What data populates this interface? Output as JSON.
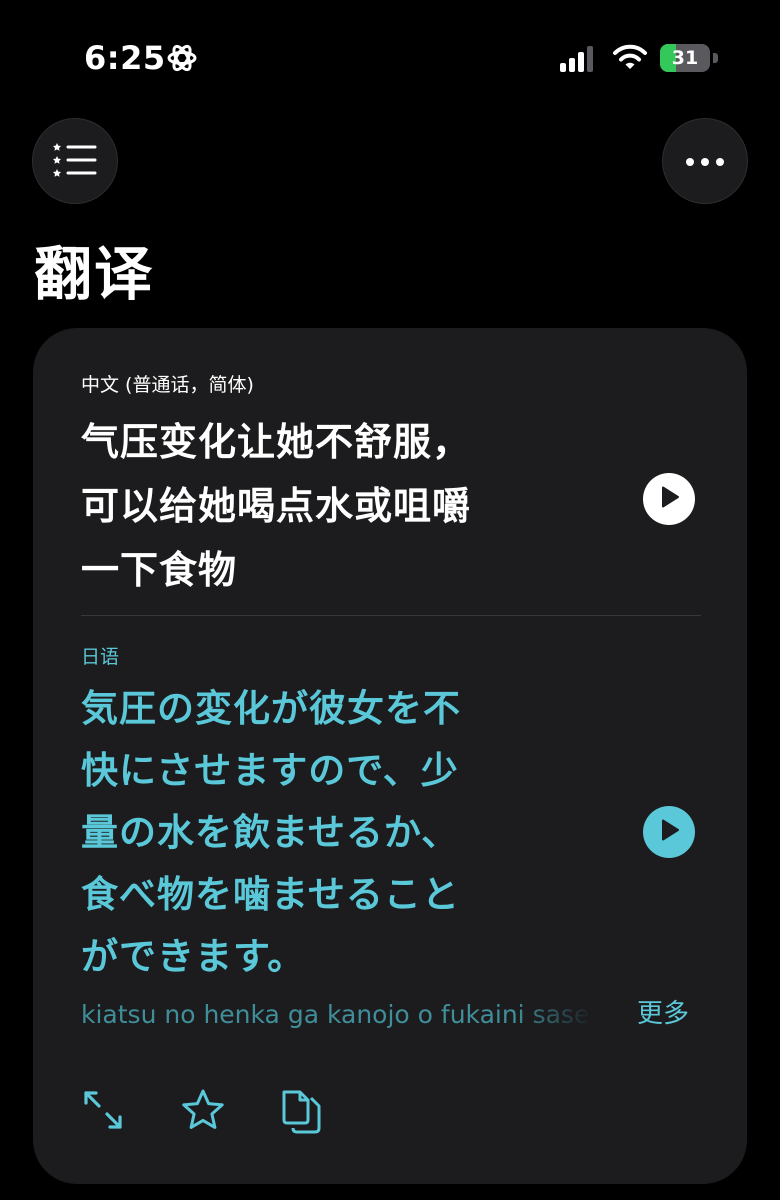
{
  "status_bar": {
    "time": "6:25",
    "battery_percent": "31",
    "battery_level": 0.31,
    "icons": [
      "focus-icon",
      "signal-icon",
      "wifi-icon",
      "battery-icon"
    ]
  },
  "header": {
    "menu_icon": "list-icon",
    "more_icon": "ellipsis-icon",
    "title": "翻译"
  },
  "card": {
    "source": {
      "language": "中文 (普通话，简体)",
      "lines": [
        "气压变化让她不舒服，",
        "可以给她喝点水或咀嚼",
        "一下食物"
      ],
      "play_icon": "play-icon"
    },
    "target": {
      "language": "日语",
      "lines": [
        "気圧の変化が彼女を不",
        "快にさせますので、少",
        "量の水を飲ませるか、",
        "食べ物を噛ませること",
        "ができます。"
      ],
      "romanization": "kiatsu no henka ga kanojo o fukaini sasemasu",
      "more_label": "更多",
      "play_icon": "play-icon"
    },
    "actions": [
      "expand-icon",
      "star-icon",
      "copy-icon"
    ]
  },
  "colors": {
    "background": "#000000",
    "card": "#1c1c1e",
    "accent": "#5ac8d8",
    "battery_green": "#34c759"
  }
}
